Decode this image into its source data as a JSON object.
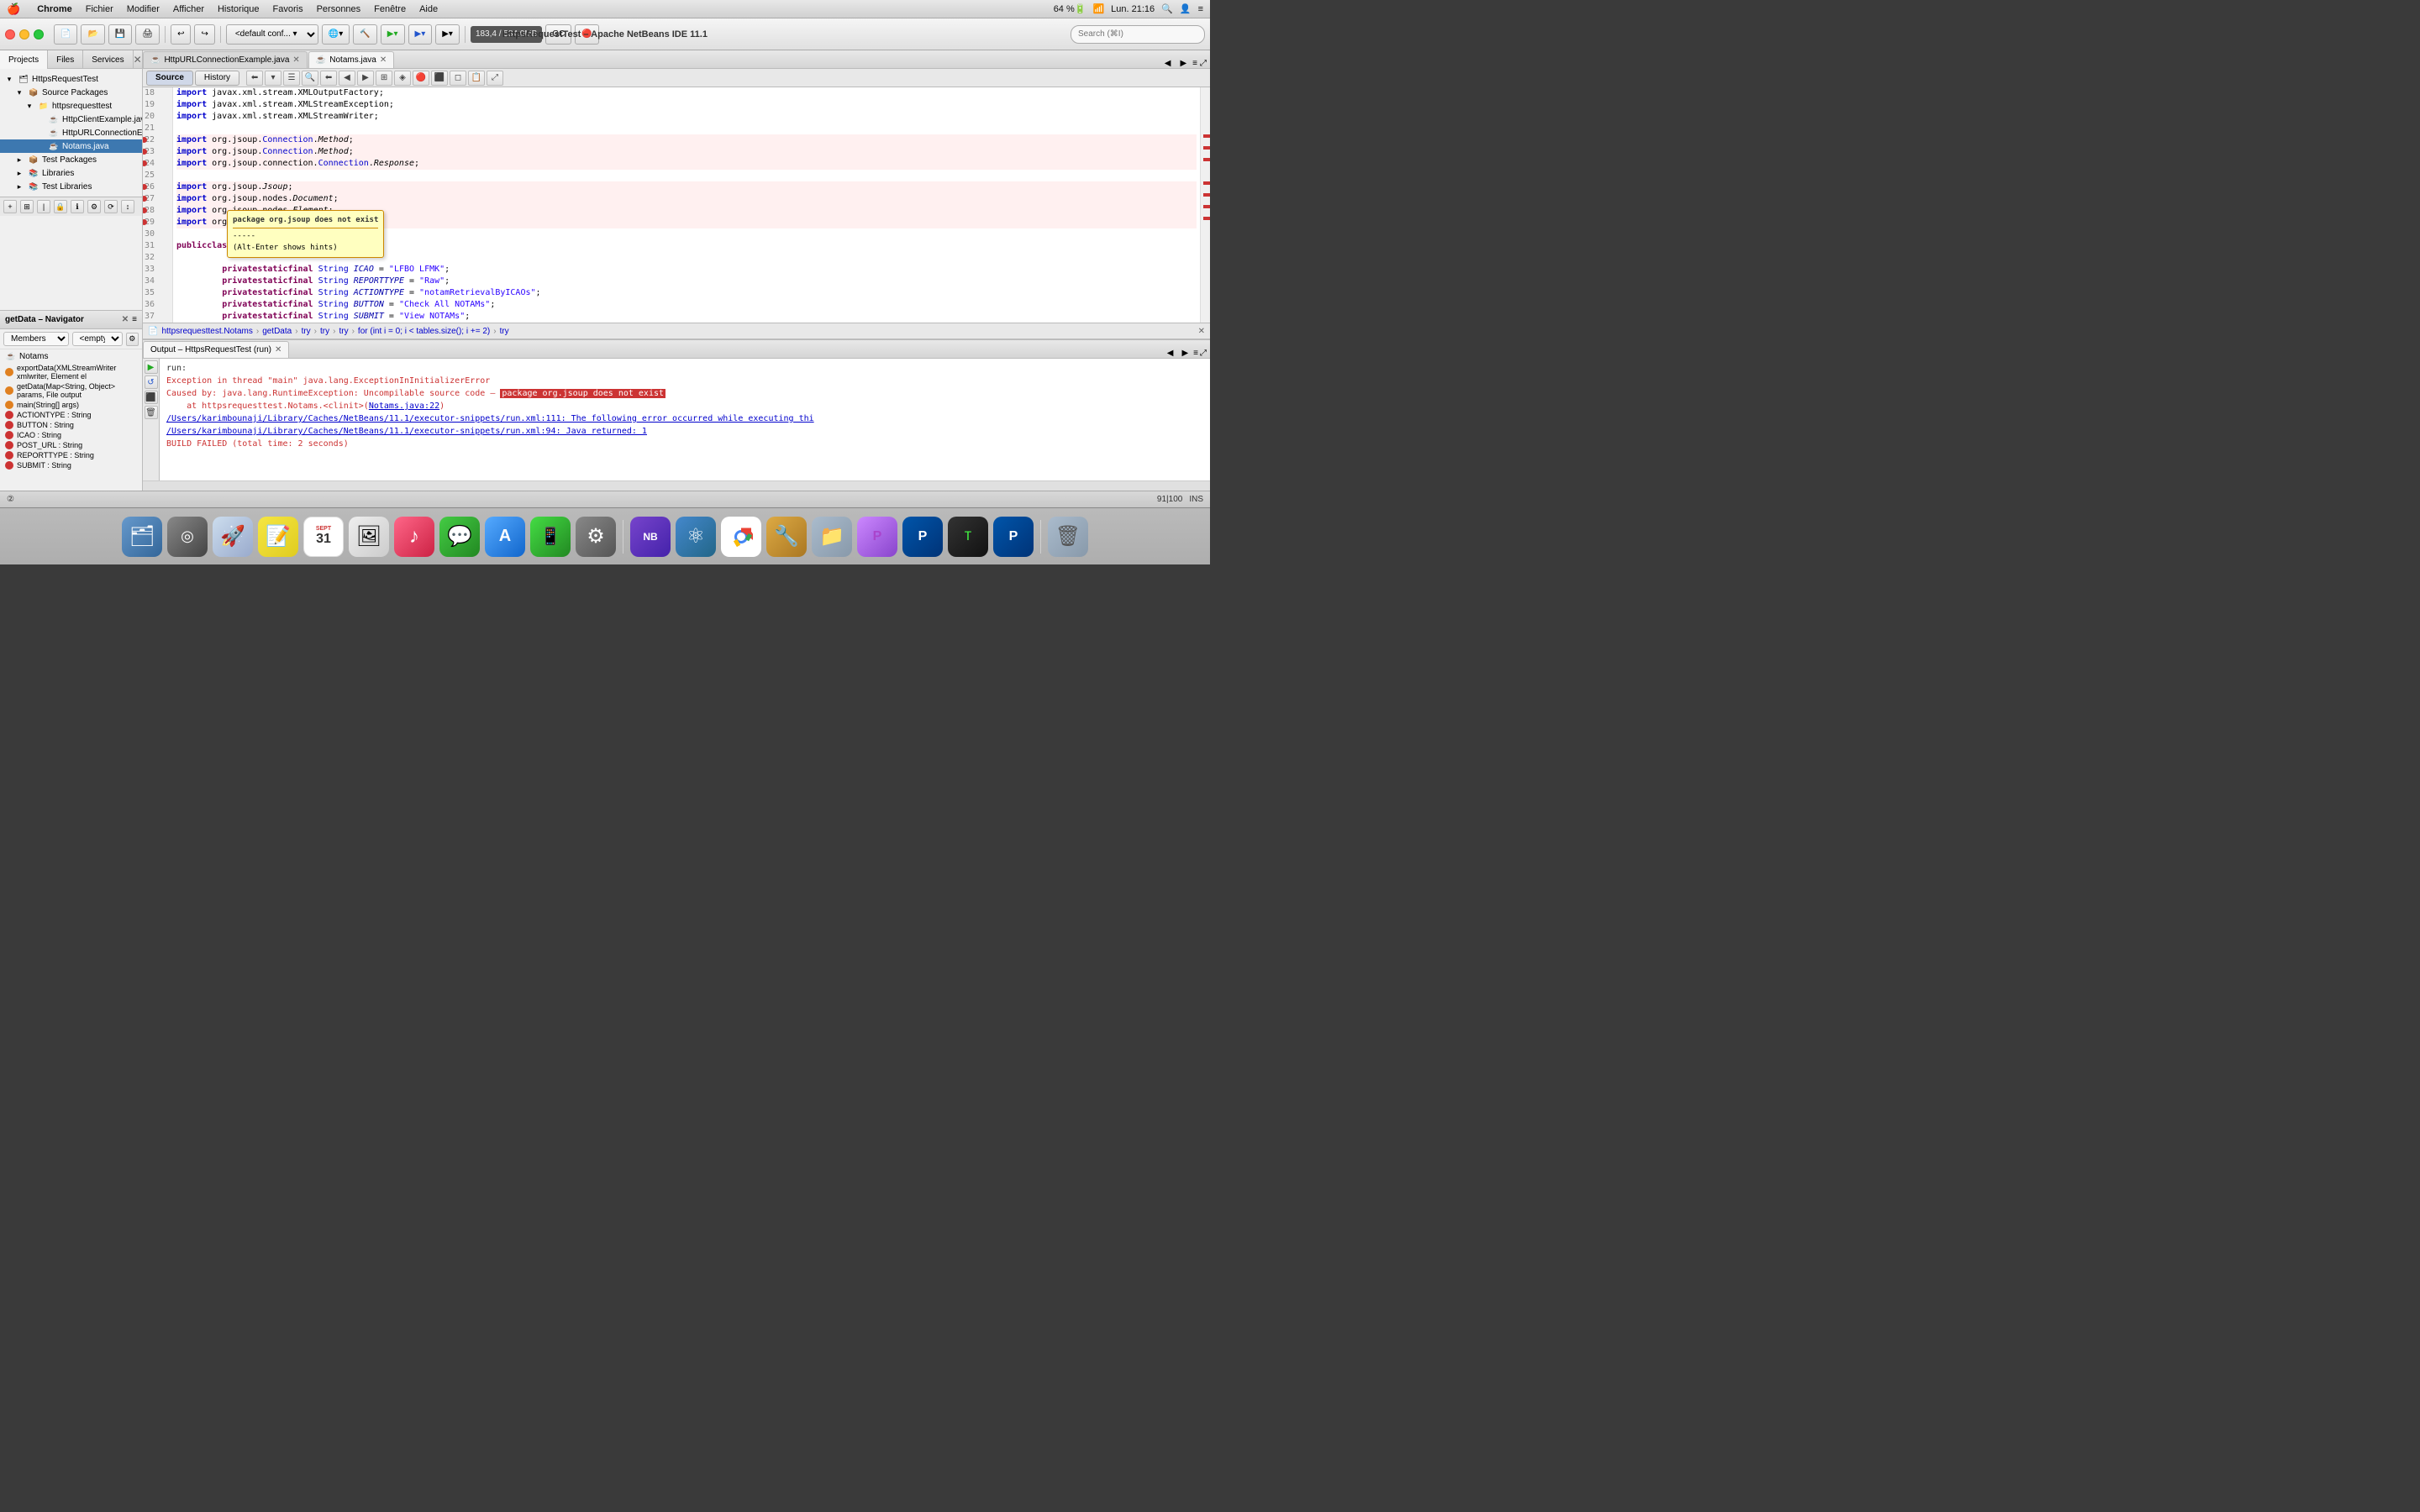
{
  "menubar": {
    "apple": "🍎",
    "chrome_label": "Chrome",
    "items": [
      "Fichier",
      "Modifier",
      "Afficher",
      "Historique",
      "Favoris",
      "Personnes",
      "Fenêtre",
      "Aide"
    ],
    "right": {
      "wifi": "📶",
      "time": "Lun. 21:16",
      "battery": "64 %🔋"
    }
  },
  "toolbar": {
    "window_title": "HttpsRequestTest – Apache NetBeans IDE 11.1",
    "config_select": "<default conf...  ▾",
    "memory": "183,4 / 534,0MB",
    "search_placeholder": "Search (⌘I)"
  },
  "left_panel": {
    "tabs": [
      "Projects",
      "Files",
      "Services"
    ],
    "project_name": "HttpsRequestTest",
    "source_packages": "Source Packages",
    "package_name": "httpsrequesttest",
    "files": [
      "HttpClientExample.java",
      "HttpURLConnectionExample.java",
      "Notams.java"
    ],
    "other_nodes": [
      "Test Packages",
      "Libraries",
      "Test Libraries"
    ]
  },
  "navigator": {
    "title": "getData – Navigator",
    "members_label": "Members",
    "empty_option": "<empty>",
    "class_name": "Notams",
    "items": [
      "exportData(XMLStreamWriter xmlwriter, Element el",
      "getData(Map<String, Object> params, File output",
      "main(String[] args)",
      "ACTIONTYPE : String",
      "BUTTON : String",
      "ICAO : String",
      "POST_URL : String",
      "REPORTTYPE : String",
      "SUBMIT : String"
    ]
  },
  "editor_tabs": [
    {
      "name": "HttpURLConnectionExample.java",
      "active": false
    },
    {
      "name": "Notams.java",
      "active": true
    }
  ],
  "source_bar": {
    "source_label": "Source",
    "history_label": "History"
  },
  "breadcrumb": {
    "parts": [
      "httpsrequesttest.Notams",
      "getData",
      "try",
      "try",
      "try",
      "for (int i = 0; i < tables.size(); i += 2)",
      "try"
    ]
  },
  "code": {
    "lines": [
      {
        "num": "18",
        "content": "    import javax.xml.stream.XMLOutputFactory;"
      },
      {
        "num": "19",
        "content": "    import javax.xml.stream.XMLStreamException;"
      },
      {
        "num": "20",
        "content": "    import javax.xml.stream.XMLStreamWriter;"
      },
      {
        "num": "21",
        "content": ""
      },
      {
        "num": "22",
        "content": "    import org.jsoup.Connection.Method;",
        "error": true
      },
      {
        "num": "23",
        "content": "    import org.jsoup.Connection.Method;",
        "error": true
      },
      {
        "num": "24",
        "content": "    import org.jsoup.connection.Connection.Response;",
        "error": true
      },
      {
        "num": "25",
        "content": ""
      },
      {
        "num": "26",
        "content": "    import org.jsoup.Jsoup;",
        "error": true
      },
      {
        "num": "27",
        "content": "    import org.jsoup.nodes.Document;",
        "error": true
      },
      {
        "num": "28",
        "content": "    import org.jsoup.nodes.Element;",
        "error": true
      },
      {
        "num": "29",
        "content": "    import org.jsoup.select.Elements;",
        "error": true
      },
      {
        "num": "30",
        "content": ""
      },
      {
        "num": "31",
        "content": "    public class Notams {"
      },
      {
        "num": "32",
        "content": ""
      },
      {
        "num": "33",
        "content": "        private static final String ICAO = \"LFBO LFMK\";"
      },
      {
        "num": "34",
        "content": "        private static final String REPORTTYPE = \"Raw\";"
      },
      {
        "num": "35",
        "content": "        private static final String ACTIONTYPE = \"notamRetrievalByICAOs\";"
      },
      {
        "num": "36",
        "content": "        private static final String BUTTON = \"Check All NOTAMs\";"
      },
      {
        "num": "37",
        "content": "        private static final String SUBMIT = \"View NOTAMs\";"
      }
    ],
    "error_tooltip": {
      "title": "package org.jsoup does not exist",
      "sep": "-----",
      "hint": "(Alt-Enter shows hints)"
    }
  },
  "output": {
    "tab_label": "Output – HttpsRequestTest (run)",
    "lines": [
      {
        "type": "normal",
        "text": "run:"
      },
      {
        "type": "error",
        "text": "Exception in thread \"main\" java.lang.ExceptionInInitializerError"
      },
      {
        "type": "error",
        "text": "Caused by: java.lang.RuntimeException: Uncompilable source code – package org.jsoup does not exist"
      },
      {
        "type": "error",
        "text": "    at httpsrequesttest.Notams.<clinit>(Notams.java:22)"
      },
      {
        "type": "link",
        "text": "/Users/karimbounaji/Library/Caches/NetBeans/11.1/executor-snippets/run.xml:111: The following error occurred while executing thi"
      },
      {
        "type": "link",
        "text": "/Users/karimbounaji/Library/Caches/NetBeans/11.1/executor-snippets/run.xml:94: Java returned: 1"
      },
      {
        "type": "error",
        "text": "BUILD FAILED (total time: 2 seconds)"
      }
    ],
    "highlighted_text": "package org.jsoup does not exist"
  },
  "status_bar": {
    "right": "91|100",
    "ins": "INS",
    "icon": "②"
  },
  "dock": {
    "items": [
      {
        "name": "finder",
        "symbol": "🗂"
      },
      {
        "name": "siri",
        "symbol": "◎"
      },
      {
        "name": "launchpad",
        "symbol": "🚀"
      },
      {
        "name": "notes",
        "symbol": "📝"
      },
      {
        "name": "calendar",
        "symbol": "31"
      },
      {
        "name": "photos",
        "symbol": "🖼"
      },
      {
        "name": "music",
        "symbol": "♪"
      },
      {
        "name": "messages",
        "symbol": "💬"
      },
      {
        "name": "appstore",
        "symbol": "A"
      },
      {
        "name": "whatsapp",
        "symbol": "📱"
      },
      {
        "name": "settings",
        "symbol": "⚙"
      },
      {
        "name": "netbeans",
        "symbol": "NB"
      },
      {
        "name": "atom",
        "symbol": "⚛"
      },
      {
        "name": "chrome",
        "symbol": "🌐"
      },
      {
        "name": "git",
        "symbol": "🔧"
      },
      {
        "name": "finder2",
        "symbol": "📁"
      },
      {
        "name": "preview",
        "symbol": "P"
      },
      {
        "name": "paypal",
        "symbol": "P"
      },
      {
        "name": "terminal",
        "symbol": "T"
      },
      {
        "name": "paypal2",
        "symbol": "P"
      },
      {
        "name": "trash",
        "symbol": "🗑"
      }
    ]
  }
}
